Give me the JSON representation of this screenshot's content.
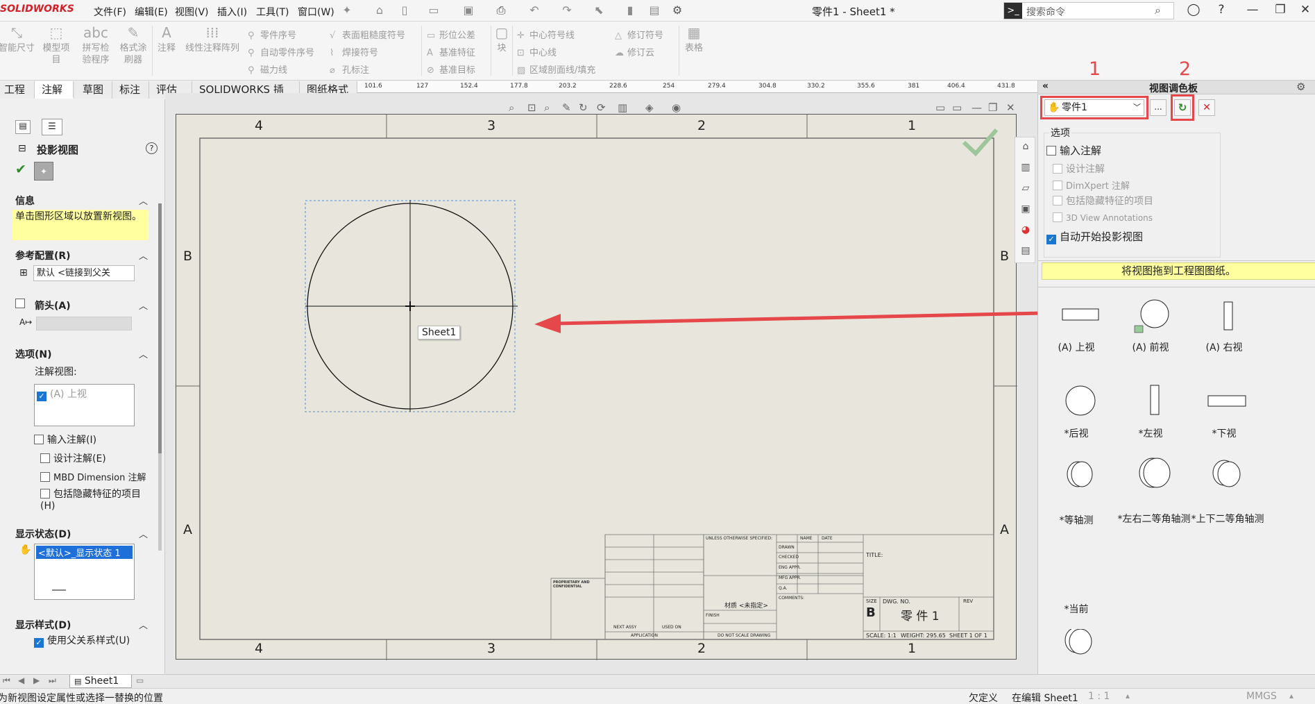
{
  "app": {
    "logo": "SOLIDWORKS",
    "doc_title": "零件1 - Sheet1 *"
  },
  "menu": [
    "文件(F)",
    "编辑(E)",
    "视图(V)",
    "插入(I)",
    "工具(T)",
    "窗口(W)"
  ],
  "search": {
    "placeholder": "搜索命令"
  },
  "command_manager": {
    "big": [
      "智能尺寸",
      "模型项目",
      "拼写检验程序",
      "格式涂刷器",
      "注释",
      "线性注释阵列"
    ],
    "col1": [
      "零件序号",
      "自动零件序号",
      "磁力线"
    ],
    "col2": [
      "表面粗糙度符号",
      "焊接符号",
      "孔标注"
    ],
    "col3": [
      "形位公差",
      "基准特征",
      "基准目标"
    ],
    "block": "块",
    "col4": [
      "中心符号线",
      "中心线",
      "区域剖面线/填充"
    ],
    "col5": [
      "修订符号",
      "修订云"
    ],
    "table": "表格"
  },
  "tabs": [
    "工程图",
    "注解",
    "草图",
    "标注",
    "评估",
    "SOLIDWORKS 插件",
    "图纸格式"
  ],
  "ruler_ticks": [
    "101.6",
    "127",
    "152.4",
    "177.8",
    "203.2",
    "228.6",
    "254",
    "279.4",
    "304.8",
    "330.2",
    "355.6",
    "381",
    "406.4",
    "431.8"
  ],
  "property_manager": {
    "title": "投影视图",
    "help": "?",
    "info_title": "信息",
    "info_text": "单击图形区域以放置新视图。",
    "ref_config_title": "参考配置(R)",
    "ref_config_value": "默认 <链接到父关",
    "arrow_title": "箭头(A)",
    "options_title": "选项(N)",
    "annotation_view_label": "注解视图:",
    "annotation_view_item": "(A) 上视",
    "import_annotations": "输入注解(I)",
    "design_annotations": "设计注解(E)",
    "mbd_annotations": "MBD Dimension 注解",
    "hidden_features": "包括隐藏特征的项目(H)",
    "display_state_title": "显示状态(D)",
    "display_state_item": "<默认>_显示状态 1",
    "display_style_title": "显示样式(D)",
    "use_parent_style": "使用父关系样式(U)"
  },
  "sheet": {
    "top_zones": [
      "4",
      "3",
      "2",
      "1"
    ],
    "bottom_zones": [
      "4",
      "3",
      "2",
      "1"
    ],
    "side_rows": [
      "B",
      "A"
    ],
    "view_label": "Sheet1",
    "title_block": {
      "proprietary": "PROPRIETARY AND CONFIDENTIAL",
      "unless": "UNLESS OTHERWISE SPECIFIED:",
      "name": "NAME",
      "date": "DATE",
      "drawn": "DRAWN",
      "checked": "CHECKED",
      "eng_appr": "ENG APPR.",
      "mfg_appr": "MFG APPR.",
      "qa": "Q.A.",
      "comments": "COMMENTS:",
      "title_label": "TITLE:",
      "material_value": "材质 <未指定>",
      "finish": "FINISH",
      "next_assy": "NEXT ASSY",
      "used_on": "USED ON",
      "application": "APPLICATION",
      "do_not_scale": "DO NOT SCALE DRAWING",
      "size": "SIZE",
      "size_value": "B",
      "dwg_no": "DWG. NO.",
      "dwg_value": "零 件 1",
      "rev": "REV",
      "scale": "SCALE: 1:1",
      "weight": "WEIGHT: 295.65",
      "sheet": "SHEET 1 OF 1"
    }
  },
  "palette": {
    "title": "视图调色板",
    "annot_label_1": "1",
    "annot_label_2": "2",
    "part_select": "零件1",
    "browse": "...",
    "options_title": "选项",
    "import_annotations": "输入注解",
    "design_annotations": "设计注解",
    "dimxpert": "DimXpert 注解",
    "hidden_items": "包括隐藏特征的项目",
    "annotations_3d": "3D View Annotations",
    "auto_projection": "自动开始投影视图",
    "drag_hint": "将视图拖到工程图图纸。",
    "views": [
      "(A) 上视",
      "(A) 前视",
      "(A) 右视",
      "*后视",
      "*左视",
      "*下视",
      "*等轴测",
      "*左右二等角轴测",
      "*上下二等角轴测",
      "*当前"
    ]
  },
  "sheet_tab": "Sheet1",
  "status": {
    "left": "为新视图设定属性或选择一替换的位置",
    "state": "欠定义",
    "editing": "在编辑 Sheet1",
    "scale": "1 : 1",
    "units": "MMGS"
  }
}
